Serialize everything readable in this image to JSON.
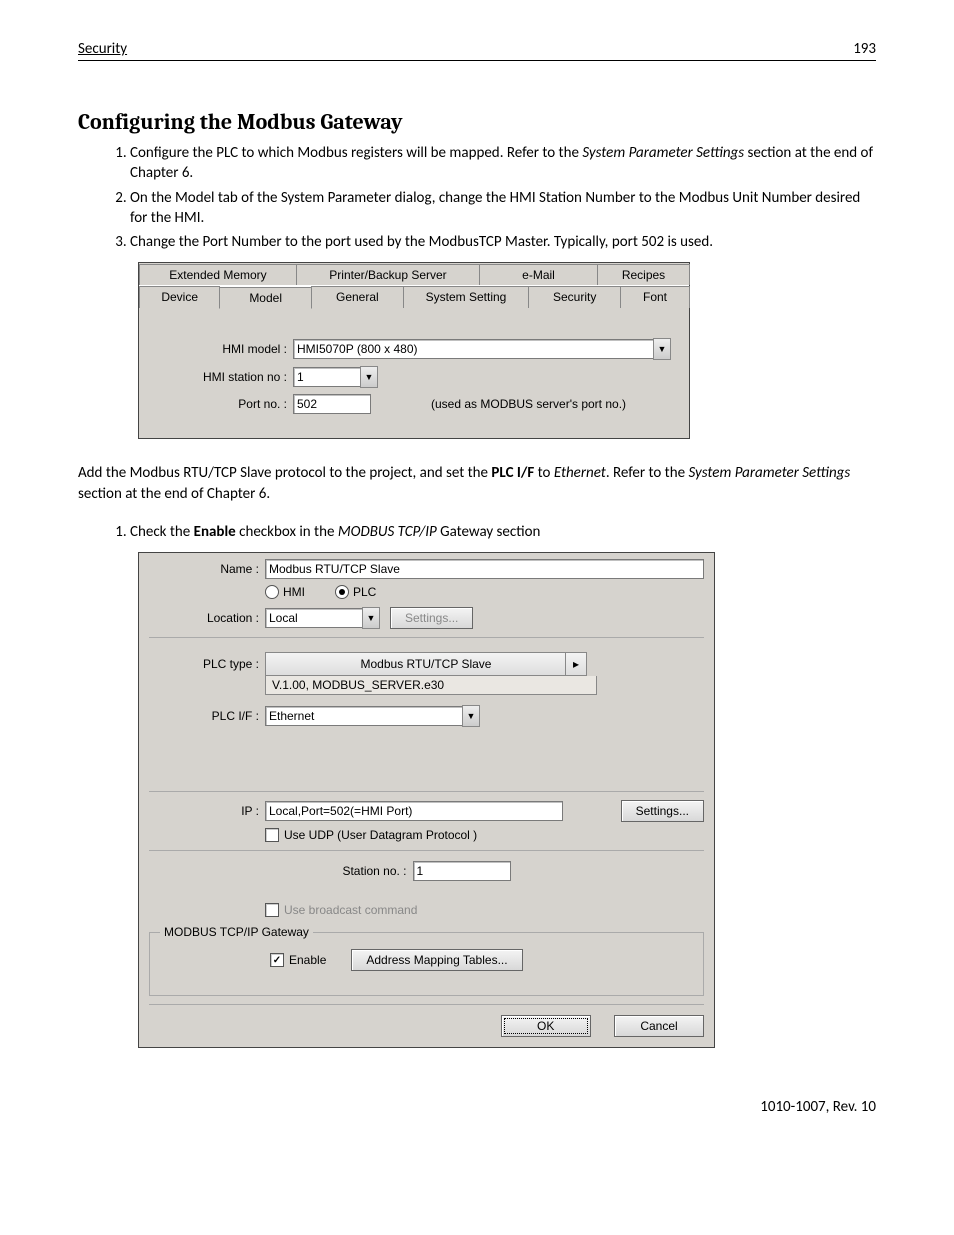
{
  "header": {
    "left": "Security",
    "right": "193"
  },
  "title": "Configuring the Modbus Gateway",
  "steps_a": [
    {
      "pre": "Configure the PLC to which Modbus registers will be mapped.  Refer to the ",
      "em": "System Parameter Settings",
      "post": " section at the end of Chapter 6."
    },
    {
      "text": "On the Model tab of the System Parameter dialog, change the HMI Station Number to the Modbus Unit Number desired for the HMI."
    },
    {
      "text": "Change the Port Number to the port used by the ModbusTCP Master.  Typically, port 502 is used."
    }
  ],
  "fig1": {
    "tabs_top": [
      "Extended Memory",
      "Printer/Backup Server",
      "e-Mail",
      "Recipes"
    ],
    "tabs_bottom": [
      "Device",
      "Model",
      "General",
      "System Setting",
      "Security",
      "Font"
    ],
    "selected_tab": "Model",
    "hmi_model_label": "HMI model :",
    "hmi_model_value": "HMI5070P (800 x 480)",
    "hmi_station_label": "HMI station no :",
    "hmi_station_value": "1",
    "port_label": "Port no. :",
    "port_value": "502",
    "port_note": "(used as MODBUS server's port no.)"
  },
  "para1": {
    "pre": "Add the Modbus RTU/TCP Slave protocol to the project, and set the ",
    "b1": "PLC I/F",
    "mid": " to ",
    "em1": "Ethernet",
    "post1": ". Refer to the ",
    "em2": "System Parameter Settings",
    "post2": " section at the end of Chapter 6."
  },
  "steps_b": [
    {
      "pre": "Check the ",
      "b": "Enable",
      "mid": " checkbox in the ",
      "em": "MODBUS TCP/IP",
      "post": " Gateway section"
    }
  ],
  "fig2": {
    "name_label": "Name :",
    "name_value": "Modbus RTU/TCP Slave",
    "radio_hmi": "HMI",
    "radio_plc": "PLC",
    "location_label": "Location :",
    "location_value": "Local",
    "settings_btn": "Settings...",
    "plc_type_label": "PLC type :",
    "plc_type_value": "Modbus RTU/TCP Slave",
    "plc_version": "V.1.00, MODBUS_SERVER.e30",
    "plc_if_label": "PLC I/F :",
    "plc_if_value": "Ethernet",
    "ip_label": "IP :",
    "ip_value": "Local,Port=502(=HMI Port)",
    "settings_btn2": "Settings...",
    "udp_label": "Use UDP (User Datagram Protocol )",
    "station_label": "Station no. :",
    "station_value": "1",
    "broadcast_label": "Use broadcast command",
    "gateway_legend": "MODBUS TCP/IP Gateway",
    "enable_label": "Enable",
    "mapping_btn": "Address Mapping Tables...",
    "ok_btn": "OK",
    "cancel_btn": "Cancel"
  },
  "footer": "1010-1007, Rev. 10"
}
